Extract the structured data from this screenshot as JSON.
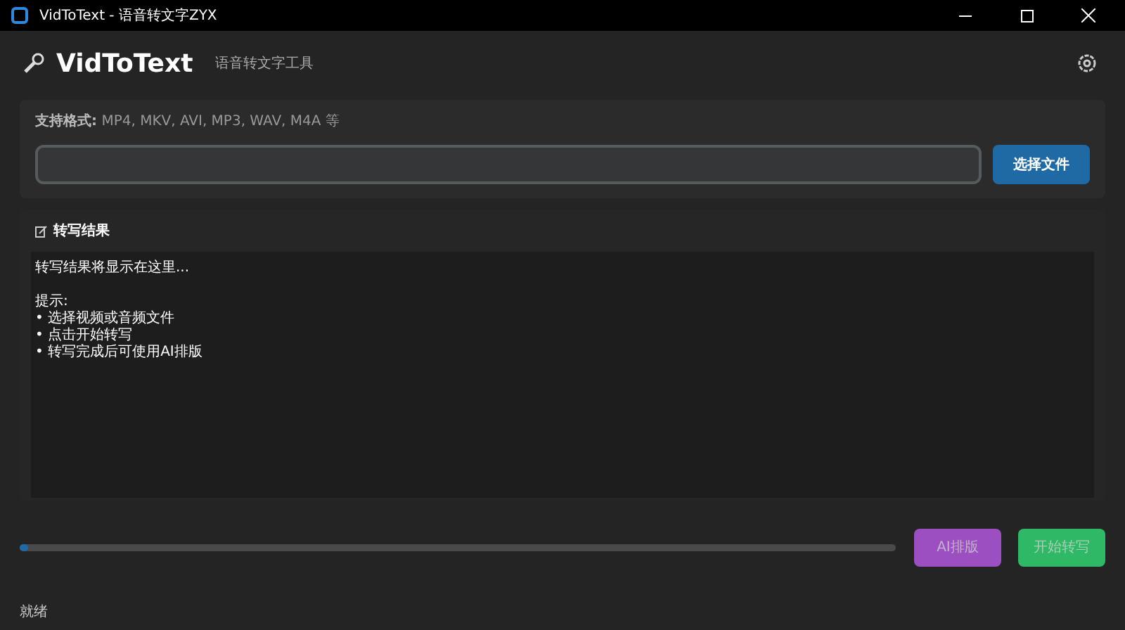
{
  "window": {
    "title": "VidToText - 语音转文字ZYX"
  },
  "header": {
    "title": "VidToText",
    "subtitle": "语音转文字工具"
  },
  "file_card": {
    "formats_label": "支持格式:",
    "formats": "MP4, MKV, AVI, MP3, WAV, M4A 等",
    "choose_button": "选择文件"
  },
  "result": {
    "title": "转写结果",
    "intro": "转写结果将显示在这里...",
    "tips_title": "提示:",
    "tips": [
      "• 选择视频或音频文件",
      "• 点击开始转写",
      "• 转写完成后可使用AI排版"
    ]
  },
  "progress": {
    "level": 0.01
  },
  "buttons": [
    {
      "label": "AI排版",
      "kind": "ai",
      "disabled": true
    },
    {
      "label": "开始转写",
      "kind": "start",
      "disabled": true
    }
  ],
  "status_bar": "就绪"
}
